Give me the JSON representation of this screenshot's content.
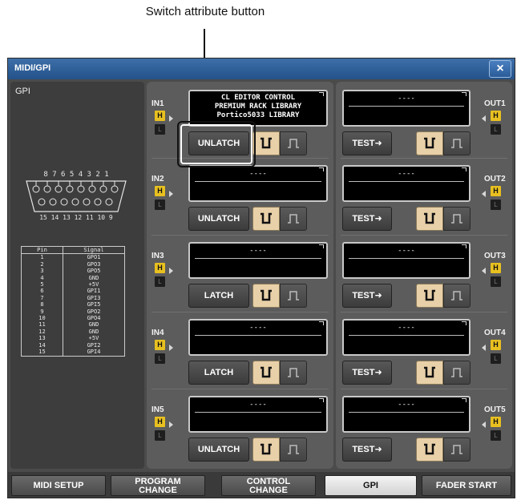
{
  "callout": {
    "label": "Switch attribute button"
  },
  "window": {
    "title": "MIDI/GPI",
    "close_icon": "×"
  },
  "left_panel": {
    "label": "GPI",
    "connector": {
      "top_pins": "8 7 6 5 4 3 2 1",
      "bottom_pins": "15 14 13 12 11 10 9"
    },
    "pin_table": {
      "headers": [
        "Pin",
        "Signal"
      ],
      "rows": [
        [
          "1",
          "GPO1"
        ],
        [
          "2",
          "GPO3"
        ],
        [
          "3",
          "GPO5"
        ],
        [
          "4",
          "GND"
        ],
        [
          "5",
          "+5V"
        ],
        [
          "6",
          "GPI1"
        ],
        [
          "7",
          "GPI3"
        ],
        [
          "8",
          "GPI5"
        ],
        [
          "9",
          "GPO2"
        ],
        [
          "10",
          "GPO4"
        ],
        [
          "11",
          "GND"
        ],
        [
          "12",
          "GND"
        ],
        [
          "13",
          "+5V"
        ],
        [
          "14",
          "GPI2"
        ],
        [
          "15",
          "GPI4"
        ]
      ]
    }
  },
  "inputs": [
    {
      "label": "IN1",
      "h": "H",
      "l": "L",
      "display": [
        "CL EDITOR CONTROL",
        "PREMIUM RACK LIBRARY",
        "Portico5033 LIBRARY"
      ],
      "mode": "UNLATCH"
    },
    {
      "label": "IN2",
      "h": "H",
      "l": "L",
      "display": [
        "----"
      ],
      "mode": "UNLATCH"
    },
    {
      "label": "IN3",
      "h": "H",
      "l": "L",
      "display": [
        "----"
      ],
      "mode": "LATCH"
    },
    {
      "label": "IN4",
      "h": "H",
      "l": "L",
      "display": [
        "----"
      ],
      "mode": "LATCH"
    },
    {
      "label": "IN5",
      "h": "H",
      "l": "L",
      "display": [
        "----"
      ],
      "mode": "UNLATCH"
    }
  ],
  "outputs": [
    {
      "label": "OUT1",
      "h": "H",
      "l": "L",
      "display": [
        "----"
      ],
      "test": "TEST➜"
    },
    {
      "label": "OUT2",
      "h": "H",
      "l": "L",
      "display": [
        "----"
      ],
      "test": "TEST➜"
    },
    {
      "label": "OUT3",
      "h": "H",
      "l": "L",
      "display": [
        "----"
      ],
      "test": "TEST➜"
    },
    {
      "label": "OUT4",
      "h": "H",
      "l": "L",
      "display": [
        "----"
      ],
      "test": "TEST➜"
    },
    {
      "label": "OUT5",
      "h": "H",
      "l": "L",
      "display": [
        "----"
      ],
      "test": "TEST➜"
    }
  ],
  "tabs": [
    {
      "label": "MIDI SETUP",
      "active": false
    },
    {
      "label": "PROGRAM\nCHANGE",
      "active": false
    },
    {
      "label": "CONTROL\nCHANGE",
      "active": false
    },
    {
      "label": "GPI",
      "active": true
    },
    {
      "label": "FADER START",
      "active": false
    }
  ],
  "colors": {
    "title_bar": "#2f5f99",
    "high_indicator": "#e8c020",
    "polarity_active": "#e8d0a8",
    "tab_active": "#e6e6e6"
  }
}
